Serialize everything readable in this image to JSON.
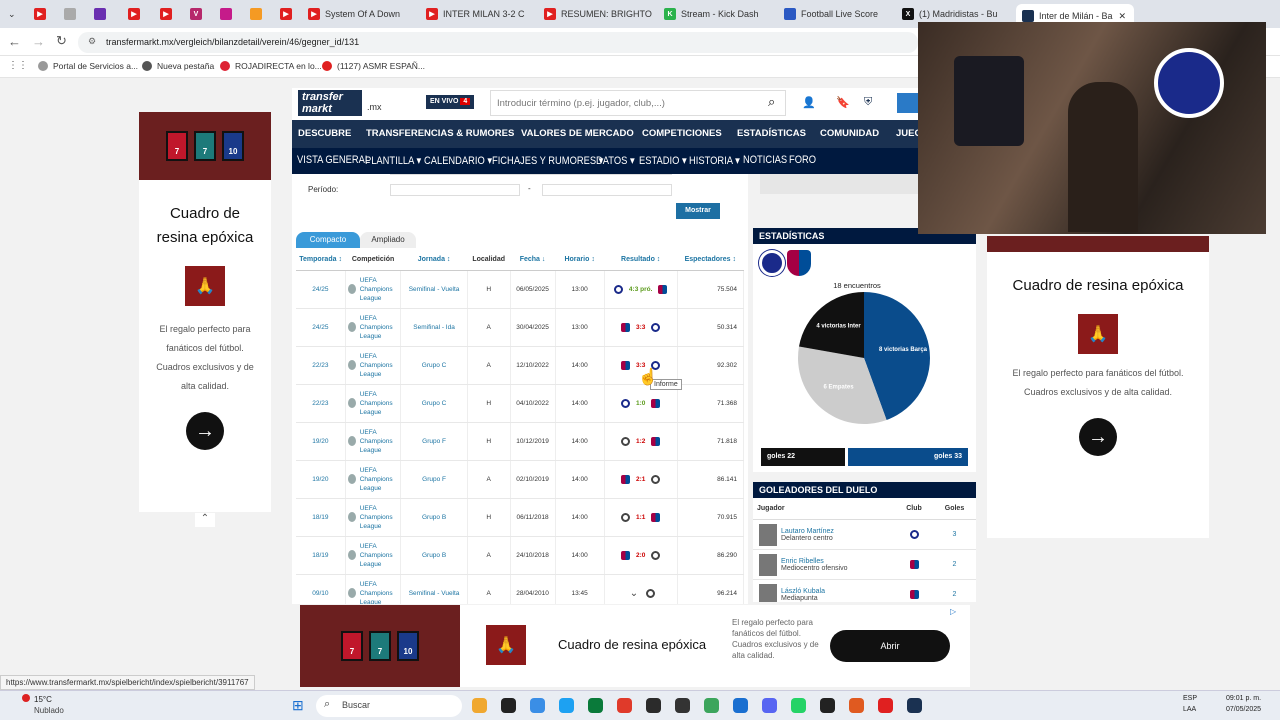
{
  "browser": {
    "tabs": [
      "",
      "",
      "",
      "",
      "",
      "",
      "",
      "",
      "",
      "System Of A Down",
      "INTER MILAN 3-2 C",
      "RESUMEN: BRIGHTO",
      "Stream - Kick Dash",
      "Football Live Score",
      "(1) Madridistas - Bu",
      "Inter de Milán - Ba"
    ],
    "url": "transfermarkt.mx/vergleich/bilanzdetail/verein/46/gegner_id/131",
    "bookmarks": [
      "Portal de Servicios a...",
      "Nueva pestaña",
      "ROJADIRECTA en lo...",
      "(1127) ASMR ESPAÑ..."
    ],
    "status_link": "https://www.transfermarkt.mx/spielbericht/index/spielbericht/3911767"
  },
  "tm": {
    "logo": "transfer markt",
    "domain": ".mx",
    "live_label": "EN VIVO",
    "live_count": "4",
    "search_placeholder": "Introducir término (p.ej. jugador, club,...)",
    "nav": [
      "DESCUBRE",
      "TRANSFERENCIAS & RUMORES",
      "VALORES DE MERCADO",
      "COMPETICIONES",
      "ESTADÍSTICAS",
      "COMUNIDAD",
      "JUEG"
    ],
    "subnav": [
      "VISTA GENERAL",
      "PLANTILLA",
      "CALENDARIO",
      "FICHAJES Y RUMORES",
      "DATOS",
      "ESTADIO",
      "HISTORIA",
      "NOTICIAS",
      "FORO"
    ],
    "period_label": "Período:",
    "show_button": "Mostrar",
    "tabs": [
      "Compacto",
      "Ampliado"
    ],
    "columns": [
      "Temporada",
      "Competición",
      "Jornada",
      "Localidad",
      "Fecha",
      "Horario",
      "Resultado",
      "Espectadores"
    ],
    "rows": [
      {
        "season": "24/25",
        "comp": "UEFA Champions League",
        "round": "Semifinal - Vuelta",
        "venue": "H",
        "date": "06/05/2025",
        "time": "13:00",
        "result": "4:3 pró.",
        "home": "inter",
        "away": "barca",
        "att": "75.504"
      },
      {
        "season": "24/25",
        "comp": "UEFA Champions League",
        "round": "Semifinal - Ida",
        "venue": "A",
        "date": "30/04/2025",
        "time": "13:00",
        "result": "3:3",
        "home": "barca",
        "away": "inter",
        "att": "50.314"
      },
      {
        "season": "22/23",
        "comp": "UEFA Champions League",
        "round": "Grupo C",
        "venue": "A",
        "date": "12/10/2022",
        "time": "14:00",
        "result": "3:3",
        "home": "barca",
        "away": "inter",
        "att": "92.302"
      },
      {
        "season": "22/23",
        "comp": "UEFA Champions League",
        "round": "Grupo C",
        "venue": "H",
        "date": "04/10/2022",
        "time": "14:00",
        "result": "1:0",
        "home": "inter",
        "away": "barca",
        "att": "71.368"
      },
      {
        "season": "19/20",
        "comp": "UEFA Champions League",
        "round": "Grupo F",
        "venue": "H",
        "date": "10/12/2019",
        "time": "14:00",
        "result": "1:2",
        "home": "neutral",
        "away": "barca",
        "att": "71.818"
      },
      {
        "season": "19/20",
        "comp": "UEFA Champions League",
        "round": "Grupo F",
        "venue": "A",
        "date": "02/10/2019",
        "time": "14:00",
        "result": "2:1",
        "home": "barca",
        "away": "neutral",
        "att": "86.141"
      },
      {
        "season": "18/19",
        "comp": "UEFA Champions League",
        "round": "Grupo B",
        "venue": "H",
        "date": "06/11/2018",
        "time": "14:00",
        "result": "1:1",
        "home": "neutral",
        "away": "barca",
        "att": "70.915"
      },
      {
        "season": "18/19",
        "comp": "UEFA Champions League",
        "round": "Grupo B",
        "venue": "A",
        "date": "24/10/2018",
        "time": "14:00",
        "result": "2:0",
        "home": "barca",
        "away": "neutral",
        "att": "86.290"
      },
      {
        "season": "09/10",
        "comp": "UEFA Champions League",
        "round": "Semifinal - Vuelta",
        "venue": "A",
        "date": "28/04/2010",
        "time": "13:45",
        "result": "",
        "home": "barca",
        "away": "neutral",
        "att": "96.214"
      }
    ],
    "tooltip": "Informe",
    "stats_title": "ESTADÍSTICAS",
    "encounters": "18 encuentros",
    "goals_left": "goles 22",
    "goals_right": "goles 33",
    "scorers_title": "GOLEADORES DEL DUELO",
    "scorer_cols": [
      "Jugador",
      "Club",
      "Goles"
    ],
    "scorers": [
      {
        "name": "Lautaro Martínez",
        "pos": "Delantero centro",
        "club": "inter",
        "goals": "3"
      },
      {
        "name": "Enric Ribelles",
        "pos": "Mediocentro ofensivo",
        "club": "barca",
        "goals": "2"
      },
      {
        "name": "László Kubala",
        "pos": "Mediapunta",
        "club": "barca",
        "goals": "2"
      }
    ]
  },
  "chart_data": {
    "type": "pie",
    "title": "18 encuentros",
    "series": [
      {
        "name": "victorias Barça",
        "value": 8,
        "color": "#0a4c8c"
      },
      {
        "name": "Empates",
        "value": 6,
        "color": "#cccccc"
      },
      {
        "name": "victorias Inter",
        "value": 4,
        "color": "#111111"
      }
    ]
  },
  "ads": {
    "title": "Cuadro de resina epóxica",
    "text": "El regalo perfecto para fanáticos del fútbol. Cuadros exclusivos y de alta calidad.",
    "open_button": "Abrir",
    "jersey_numbers": [
      "7",
      "7",
      "10"
    ]
  },
  "taskbar": {
    "weather_temp": "15°C",
    "weather_desc": "Nublado",
    "search": "Buscar",
    "lang": "ESP",
    "lang2": "LAA",
    "time": "09:01 p. m.",
    "date": "07/05/2025"
  }
}
